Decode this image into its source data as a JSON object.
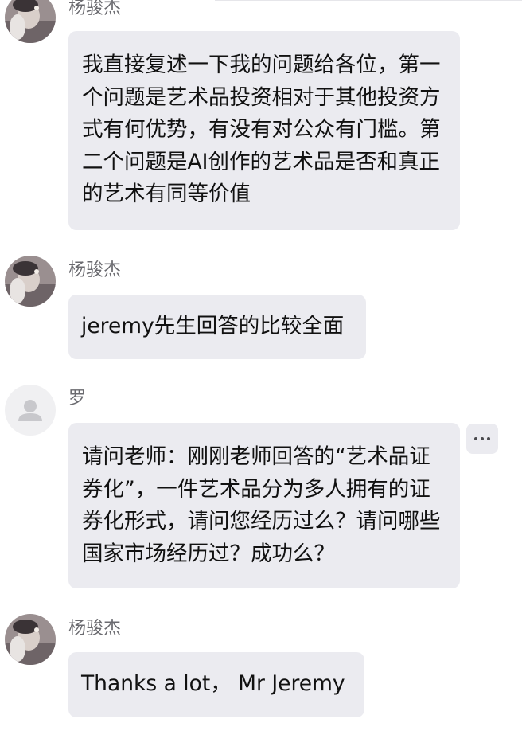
{
  "messages": [
    {
      "sender": "杨骏杰",
      "avatar": "user-photo-avatar",
      "text": "我直接复述一下我的问题给各位，第一个问题是艺术品投资相对于其他投资方式有何优势，有没有对公众有门槛。第二个问题是AI创作的艺术品是否和真正的艺术有同等价值"
    },
    {
      "sender": "杨骏杰",
      "avatar": "user-photo-avatar",
      "text": "jeremy先生回答的比较全面"
    },
    {
      "sender": "罗",
      "avatar": "default-avatar",
      "text": "请问老师：刚刚老师回答的“艺术品证券化”，一件艺术品分为多人拥有的证券化形式，请问您经历过么？请问哪些国家市场经历过？成功么？",
      "more_icon": "more-horizontal-icon"
    },
    {
      "sender": "杨骏杰",
      "avatar": "user-photo-avatar",
      "text": "Thanks a lot， Mr Jeremy"
    }
  ],
  "colors": {
    "bubble_bg": "#ebebf0",
    "sender_text": "#6b6b70",
    "message_text": "#111111",
    "default_avatar_bg": "#f0f0f2",
    "default_avatar_fg": "#c8c8cc"
  }
}
